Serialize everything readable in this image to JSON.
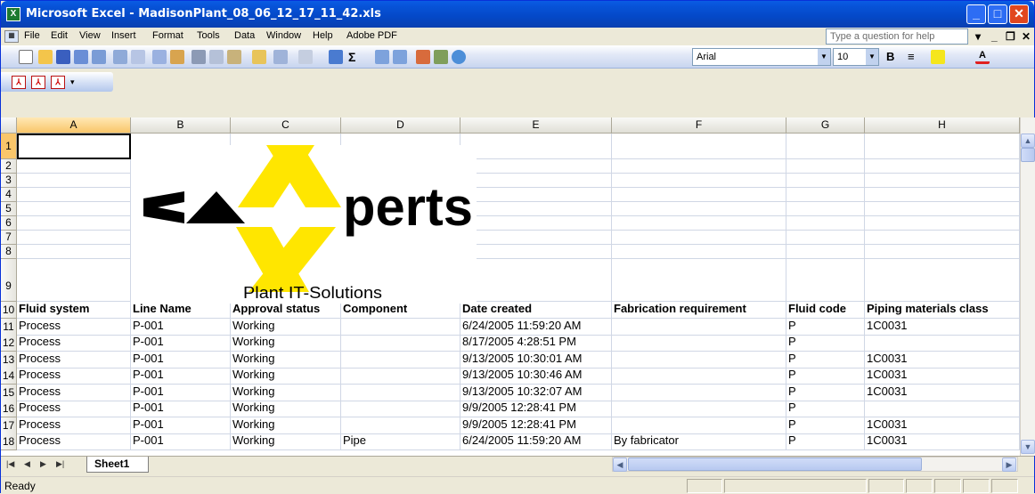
{
  "window": {
    "title": "Microsoft Excel - MadisonPlant_08_06_12_17_11_42.xls",
    "app_icon": "excel-icon"
  },
  "menu": {
    "items": [
      "File",
      "Edit",
      "View",
      "Insert",
      "Format",
      "Tools",
      "Data",
      "Window",
      "Help",
      "Adobe PDF"
    ],
    "help_placeholder": "Type a question for help"
  },
  "formatting": {
    "font": "Arial",
    "size": "10"
  },
  "columns": [
    "A",
    "B",
    "C",
    "D",
    "E",
    "F",
    "G",
    "H"
  ],
  "rows": [
    "1",
    "2",
    "3",
    "4",
    "5",
    "6",
    "7",
    "8",
    "9",
    "10",
    "11",
    "12",
    "13",
    "14",
    "15",
    "16",
    "17",
    "18"
  ],
  "logo": {
    "brand": "CAXperts",
    "left_letters": "CA",
    "x_letter": "X",
    "right_letters": "perts",
    "tagline": "Plant IT-Solutions",
    "accent_color": "#ffe600"
  },
  "table": {
    "headers": [
      "Fluid system",
      "Line Name",
      "Approval status",
      "Component",
      "Date created",
      "Fabrication requirement",
      "Fluid code",
      "Piping materials class"
    ],
    "rows": [
      [
        "Process",
        "P-001",
        "Working",
        "",
        "6/24/2005 11:59:20 AM",
        "",
        "P",
        "1C0031"
      ],
      [
        "Process",
        "P-001",
        "Working",
        "",
        "8/17/2005 4:28:51 PM",
        "",
        "P",
        ""
      ],
      [
        "Process",
        "P-001",
        "Working",
        "",
        "9/13/2005 10:30:01 AM",
        "",
        "P",
        "1C0031"
      ],
      [
        "Process",
        "P-001",
        "Working",
        "",
        "9/13/2005 10:30:46 AM",
        "",
        "P",
        "1C0031"
      ],
      [
        "Process",
        "P-001",
        "Working",
        "",
        "9/13/2005 10:32:07 AM",
        "",
        "P",
        "1C0031"
      ],
      [
        "Process",
        "P-001",
        "Working",
        "",
        "9/9/2005 12:28:41 PM",
        "",
        "P",
        ""
      ],
      [
        "Process",
        "P-001",
        "Working",
        "",
        "9/9/2005 12:28:41 PM",
        "",
        "P",
        "1C0031"
      ],
      [
        "Process",
        "P-001",
        "Working",
        "Pipe",
        "6/24/2005 11:59:20 AM",
        "By fabricator",
        "P",
        "1C0031"
      ]
    ]
  },
  "sheet": {
    "tab": "Sheet1",
    "status": "Ready"
  }
}
